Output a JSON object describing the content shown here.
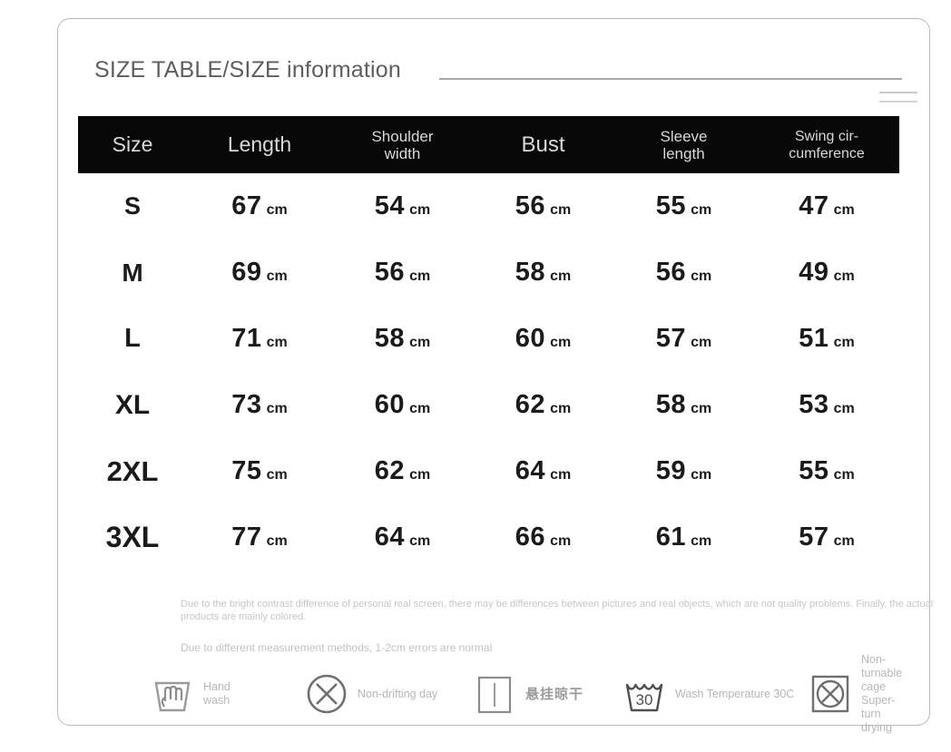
{
  "header": {
    "title": "SIZE TABLE/SIZE information",
    "rule_icon": "horizontal-rule",
    "menu_icon": "hamburger-lines-icon"
  },
  "table": {
    "columns": [
      {
        "key": "size",
        "label": "Size"
      },
      {
        "key": "length",
        "label": "Length"
      },
      {
        "key": "shoulder_width",
        "label": "Shoulder\nwidth"
      },
      {
        "key": "bust",
        "label": "Bust"
      },
      {
        "key": "sleeve_length",
        "label": "Sleeve\nlength"
      },
      {
        "key": "swing_circumference",
        "label": "Swing cir-\ncumference"
      }
    ],
    "unit": "cm",
    "rows": [
      {
        "size": "S",
        "length": "67",
        "shoulder_width": "54",
        "bust": "56",
        "sleeve_length": "55",
        "swing_circumference": "47"
      },
      {
        "size": "M",
        "length": "69",
        "shoulder_width": "56",
        "bust": "58",
        "sleeve_length": "56",
        "swing_circumference": "49"
      },
      {
        "size": "L",
        "length": "71",
        "shoulder_width": "58",
        "bust": "60",
        "sleeve_length": "57",
        "swing_circumference": "51"
      },
      {
        "size": "XL",
        "length": "73",
        "shoulder_width": "60",
        "bust": "62",
        "sleeve_length": "58",
        "swing_circumference": "53"
      },
      {
        "size": "2XL",
        "length": "75",
        "shoulder_width": "62",
        "bust": "64",
        "sleeve_length": "59",
        "swing_circumference": "55"
      },
      {
        "size": "3XL",
        "length": "77",
        "shoulder_width": "64",
        "bust": "66",
        "sleeve_length": "61",
        "swing_circumference": "57"
      }
    ]
  },
  "notes": {
    "disclaimer": "Due to the bright contrast difference of personal real screen, there may be differences between pictures and real objects, which are not quality problems. Finally, the actual products are mainly colored.",
    "measurement": "Due to different measurement methods, 1-2cm errors are normal"
  },
  "care_instructions": [
    {
      "icon": "hand-wash-icon",
      "label": "Hand\nwash"
    },
    {
      "icon": "no-bleach-circle-x-icon",
      "label": "Non-drifting day"
    },
    {
      "icon": "drip-dry-square-icon",
      "label": "悬挂晾干"
    },
    {
      "icon": "wash-temperature-30-icon",
      "label": "Wash Temperature 30C"
    },
    {
      "icon": "no-tumble-dry-icon",
      "label": "Non-turnable cage\nSuper-turn drying"
    }
  ],
  "colors": {
    "header_band": "#080808",
    "card_border": "#b9b9b9",
    "title_text": "#5e5e5e",
    "note_text": "#c4c4c4",
    "care_text": "#b7b7b7"
  }
}
